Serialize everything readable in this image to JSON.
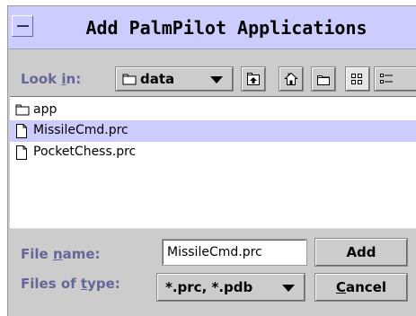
{
  "dialog": {
    "title": "Add PalmPilot Applications"
  },
  "lookin": {
    "label_pre": "Look ",
    "label_mnemonic": "i",
    "label_post": "n:",
    "value": "data",
    "toolbar_icons": [
      "up-one-level-icon",
      "home-icon",
      "new-folder-icon",
      "list-view-icon",
      "details-view-icon"
    ]
  },
  "files": [
    {
      "name": "app",
      "type": "folder",
      "selected": false
    },
    {
      "name": "MissileCmd.prc",
      "type": "file",
      "selected": true
    },
    {
      "name": "PocketChess.prc",
      "type": "file",
      "selected": false
    }
  ],
  "filename": {
    "label_pre": "File ",
    "label_mnemonic": "n",
    "label_post": "ame:",
    "value": "MissileCmd.prc"
  },
  "filetype": {
    "label_pre": "Files of ",
    "label_mnemonic": "t",
    "label_post": "ype:",
    "value": "*.prc, *.pdb"
  },
  "buttons": {
    "add_label": "Add",
    "cancel_mnemonic": "C",
    "cancel_rest": "ancel"
  },
  "colors": {
    "title_bar": "#ccccff",
    "selection": "#ccccff",
    "dialog_bg": "#cccccc",
    "label_text": "#666699"
  }
}
